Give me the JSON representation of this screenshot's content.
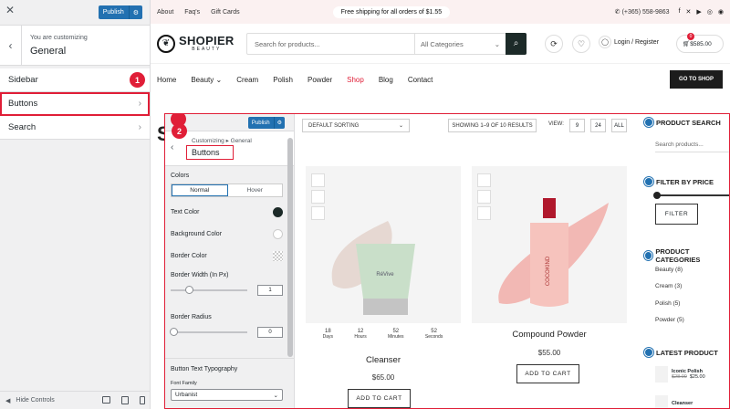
{
  "customizer": {
    "publish_label": "Publish",
    "header_sub": "You are customizing",
    "header_title": "General",
    "menu": [
      {
        "label": "Sidebar"
      },
      {
        "label": "Buttons"
      },
      {
        "label": "Search"
      }
    ],
    "hide_controls": "Hide Controls"
  },
  "annotations": {
    "badge1": "1",
    "badge2": "2"
  },
  "site": {
    "top_links": [
      "About",
      "Faq's",
      "Gift Cards"
    ],
    "shipping_text": "Free shipping for all orders of $1.55",
    "phone": "(+365) 558-9863",
    "logo_name": "SHOPIER",
    "logo_tag": "BEAUTY",
    "search_placeholder": "Search for products...",
    "search_category": "All Categories",
    "login_label": "Login / Register",
    "cart_count": "0",
    "cart_total": "$585.00",
    "nav": [
      "Home",
      "Beauty",
      "Cream",
      "Polish",
      "Powder",
      "Shop",
      "Blog",
      "Contact"
    ],
    "go_to_shop": "GO TO SHOP",
    "bg_title": "S"
  },
  "inner_panel": {
    "publish_label": "Publish",
    "breadcrumb": "Customizing ▸ General",
    "title": "Buttons",
    "colors_label": "Colors",
    "tab_normal": "Normal",
    "tab_hover": "Hover",
    "text_color": "Text Color",
    "background_color": "Background Color",
    "border_color": "Border Color",
    "border_width_label": "Border Width (In Px)",
    "border_width_value": "1",
    "border_radius_label": "Border Radius",
    "border_radius_value": "0",
    "typography_label": "Button Text Typography",
    "font_family_label": "Font Family",
    "font_family_value": "Urbanist",
    "text_color_hex": "#1c2a28"
  },
  "shop": {
    "sorting": "DEFAULT SORTING",
    "results": "SHOWING 1–9 OF 10 RESULTS",
    "view_label": "VIEW:",
    "view_options": [
      "9",
      "24",
      "ALL"
    ],
    "timer": [
      {
        "num": "18",
        "unit": "Days"
      },
      {
        "num": "12",
        "unit": "Hours"
      },
      {
        "num": "52",
        "unit": "Minutes"
      },
      {
        "num": "52",
        "unit": "Seconds"
      }
    ],
    "products": [
      {
        "name": "Cleanser",
        "price": "$65.00",
        "button": "ADD TO CART",
        "tube_brand": "RéVive"
      },
      {
        "name": "Compound Powder",
        "price": "$55.00",
        "button": "ADD TO CART",
        "bottle_brand": "COCOKIND"
      }
    ]
  },
  "widgets": {
    "product_search": "PRODUCT SEARCH",
    "search_placeholder": "Search products...",
    "filter_by_price": "FILTER BY PRICE",
    "filter_button": "FILTER",
    "categories_title": "PRODUCT CATEGORIES",
    "categories": [
      "Beauty (8)",
      "Cream (3)",
      "Polish (5)",
      "Powder (5)"
    ],
    "latest_title": "LATEST PRODUCT",
    "latest": [
      {
        "name": "Iconic Polish",
        "old": "$28.00",
        "new": "$25.00"
      },
      {
        "name": "Cleanser"
      }
    ]
  },
  "colors": {
    "accent": "#2271b1",
    "highlight": "#e01e37",
    "dark": "#1c2a28"
  }
}
